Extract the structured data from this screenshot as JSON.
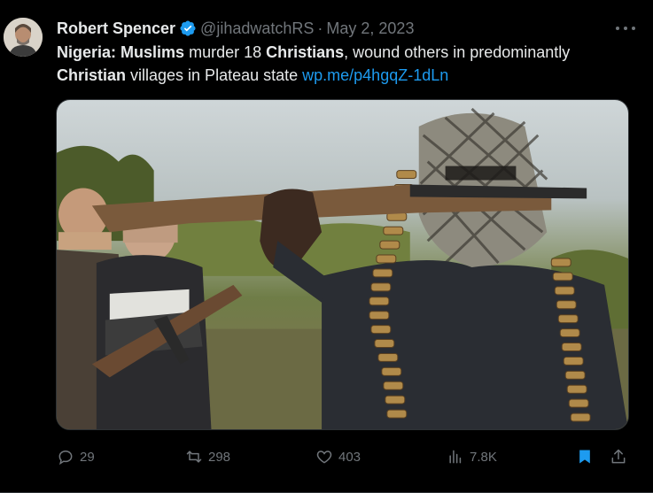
{
  "tweet": {
    "author_name": "Robert Spencer",
    "author_handle": "@jihadwatchRS",
    "separator": "·",
    "date": "May 2, 2023",
    "text_parts": {
      "p1": "Nigeria:",
      "p2": " ",
      "p3": "Muslims",
      "p4": " murder 18 ",
      "p5": "Christians",
      "p6": ", wound others in predominantly ",
      "p7": "Christian",
      "p8": " villages in Plateau state ",
      "link": "wp.me/p4hgqZ-1dLn"
    },
    "icons": {
      "verified": "verified-badge-icon",
      "more": "more-options-icon"
    }
  },
  "actions": {
    "reply_count": "29",
    "retweet_count": "298",
    "like_count": "403",
    "views_count": "7.8K"
  },
  "colors": {
    "background": "#000000",
    "text": "#e7e9ea",
    "muted": "#71767b",
    "link": "#1d9bf0",
    "bookmark_active": "#1d9bf0"
  }
}
